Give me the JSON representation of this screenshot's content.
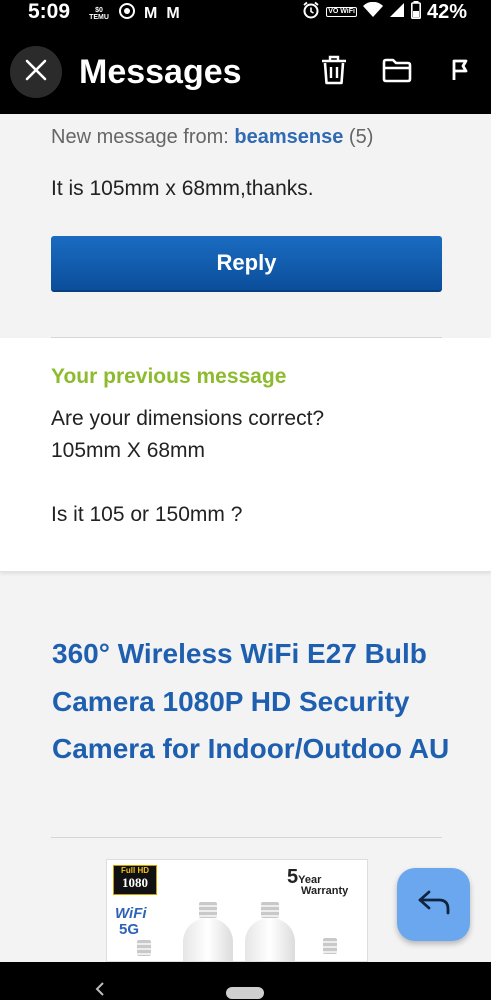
{
  "status_bar": {
    "time": "5:09",
    "notif_temu": "$0 TEMU",
    "notif_mail_1": "M",
    "notif_mail_2": "M",
    "wifi_badge": "VO WiFi",
    "battery": "42%"
  },
  "app_bar": {
    "title": "Messages",
    "icons": [
      "close-icon",
      "trash-icon",
      "folder-icon",
      "flag-icon"
    ]
  },
  "message": {
    "from_prefix": "New message from: ",
    "sender": "beamsense",
    "count": "(5)",
    "body": "It is 105mm x 68mm,thanks.",
    "reply_label": "Reply"
  },
  "previous": {
    "heading": "Your previous message",
    "line1": "Are your dimensions correct?",
    "line2": "105mm X 68mm",
    "line3": "Is it 105 or 150mm ?"
  },
  "item": {
    "title": "360° Wireless WiFi E27 Bulb Camera 1080P HD Security Camera for Indoor/Outdoo AU",
    "image": {
      "badge_top": "Full HD",
      "badge_main": "1080",
      "wifi": "WiFi",
      "band": "5G",
      "warranty_num": "5",
      "warranty_year": "Year",
      "warranty_word": "Warranty"
    }
  },
  "colors": {
    "link_blue": "#2f6ab3",
    "title_blue": "#1f5fb0",
    "green_heading": "#8dbb2e",
    "reply_button": "#0b5cb0",
    "fab": "#6aa7ef"
  }
}
